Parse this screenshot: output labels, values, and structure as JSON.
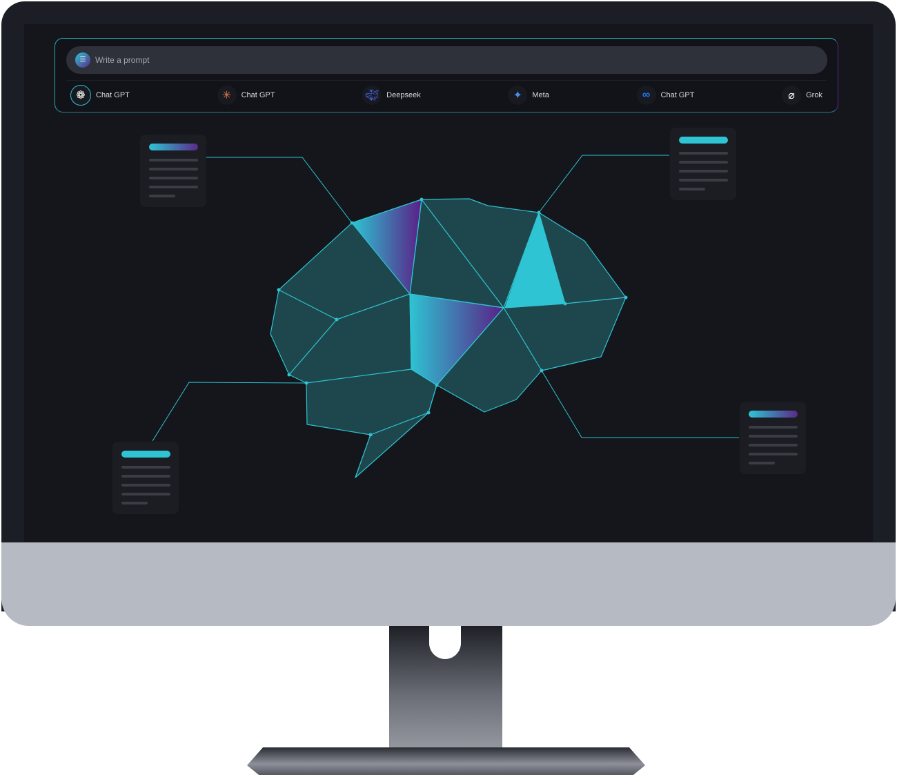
{
  "prompt": {
    "placeholder": "Write a prompt",
    "icon": "prompt-list-icon"
  },
  "models": [
    {
      "label": "Chat GPT",
      "icon": "openai-icon",
      "color": "#ffffff"
    },
    {
      "label": "Chat GPT",
      "icon": "claude-sunburst-icon",
      "color": "#e2774f"
    },
    {
      "label": "Deepseek",
      "icon": "deepseek-whale-icon",
      "color": "#4d6bfe"
    },
    {
      "label": "Meta",
      "icon": "gemini-star-icon",
      "color": "#4a8cf0"
    },
    {
      "label": "Chat GPT",
      "icon": "meta-infinity-icon",
      "color": "#1877f2"
    },
    {
      "label": "Grok",
      "icon": "grok-icon",
      "color": "#ffffff"
    }
  ],
  "colors": {
    "accent": "#2ec4d3",
    "purple": "#5a2a8a",
    "brain_fill": "#1e474d"
  }
}
